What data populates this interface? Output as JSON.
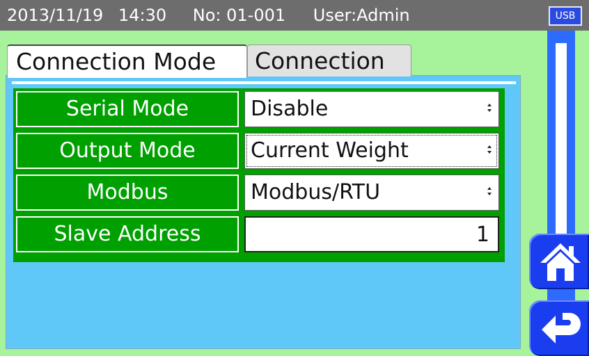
{
  "status_bar": {
    "date": "2013/11/19",
    "time": "14:30",
    "number": "No: 01-001",
    "user": "User:Admin",
    "usb_label": "USB"
  },
  "tabs": [
    {
      "label": "Connection Mode",
      "active": true
    },
    {
      "label": "Connection",
      "active": false
    }
  ],
  "settings": [
    {
      "label": "Serial Mode",
      "value": "Disable",
      "kind": "dropdown"
    },
    {
      "label": "Output Mode",
      "value": "Current Weight",
      "kind": "dropdown",
      "focused": true
    },
    {
      "label": "Modbus",
      "value": "Modbus/RTU",
      "kind": "dropdown"
    },
    {
      "label": "Slave Address",
      "value": "1",
      "kind": "number"
    }
  ],
  "nav": {
    "home_icon": "home-icon",
    "back_icon": "return-arrow-icon"
  },
  "colors": {
    "background": "#a6f39c",
    "status_bar": "#6d6d6d",
    "panel": "#5fc8f8",
    "label_bg": "#00a000",
    "accent_blue": "#1a3df0"
  }
}
